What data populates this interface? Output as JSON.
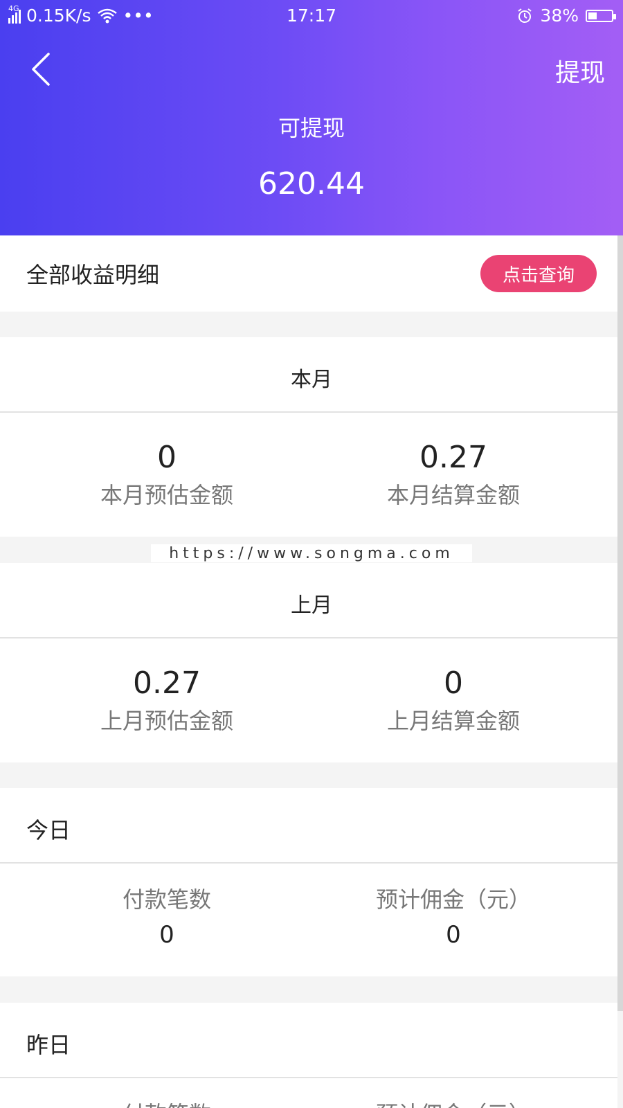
{
  "status_bar": {
    "network": "4G",
    "speed": "0.15K/s",
    "dots": "•••",
    "time": "17:17",
    "battery": "38%",
    "battery_level": 0.38
  },
  "header": {
    "action_label": "提现",
    "withdrawable_label": "可提现",
    "withdrawable_amount": "620.44"
  },
  "detail_row": {
    "title": "全部收益明细",
    "button_label": "点击查询"
  },
  "this_month": {
    "title": "本月",
    "estimate_value": "0",
    "estimate_label": "本月预估金额",
    "settled_value": "0.27",
    "settled_label": "本月结算金额"
  },
  "watermark": "https://www.songma.com",
  "last_month": {
    "title": "上月",
    "estimate_value": "0.27",
    "estimate_label": "上月预估金额",
    "settled_value": "0",
    "settled_label": "上月结算金额"
  },
  "today": {
    "title": "今日",
    "count_label": "付款笔数",
    "count_value": "0",
    "commission_label": "预计佣金（元）",
    "commission_value": "0"
  },
  "yesterday": {
    "title": "昨日",
    "count_label": "付款笔数",
    "commission_label": "预计佣金（元）"
  }
}
